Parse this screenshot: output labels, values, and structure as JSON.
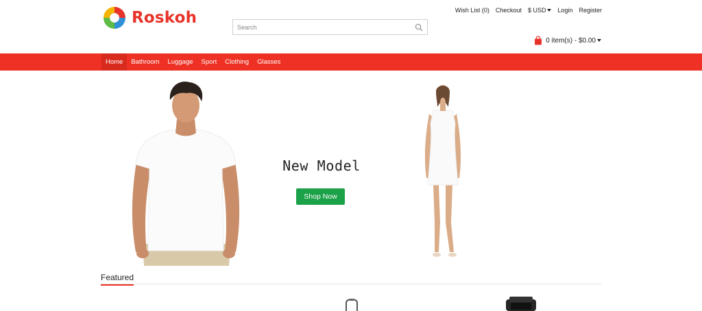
{
  "brand": {
    "name": "Roskoh",
    "accent": "#ee3124",
    "logo_text_color": "#e8332a"
  },
  "search": {
    "placeholder": "Search",
    "value": "",
    "icon": "search-icon"
  },
  "top_links": {
    "wishlist": "Wish List (0)",
    "checkout": "Checkout",
    "currency": "$ USD",
    "login": "Login",
    "register": "Register"
  },
  "cart": {
    "label": "0 item(s) - $0.00",
    "icon": "shopping-bag-icon"
  },
  "nav": {
    "items": [
      {
        "label": "Home"
      },
      {
        "label": "Bathroom"
      },
      {
        "label": "Luggage"
      },
      {
        "label": "Sport"
      },
      {
        "label": "Clothing"
      },
      {
        "label": "Glasses"
      }
    ]
  },
  "banner": {
    "title": "New Model",
    "button_label": "Shop Now",
    "button_color": "#1ba148"
  },
  "featured": {
    "heading": "Featured"
  }
}
